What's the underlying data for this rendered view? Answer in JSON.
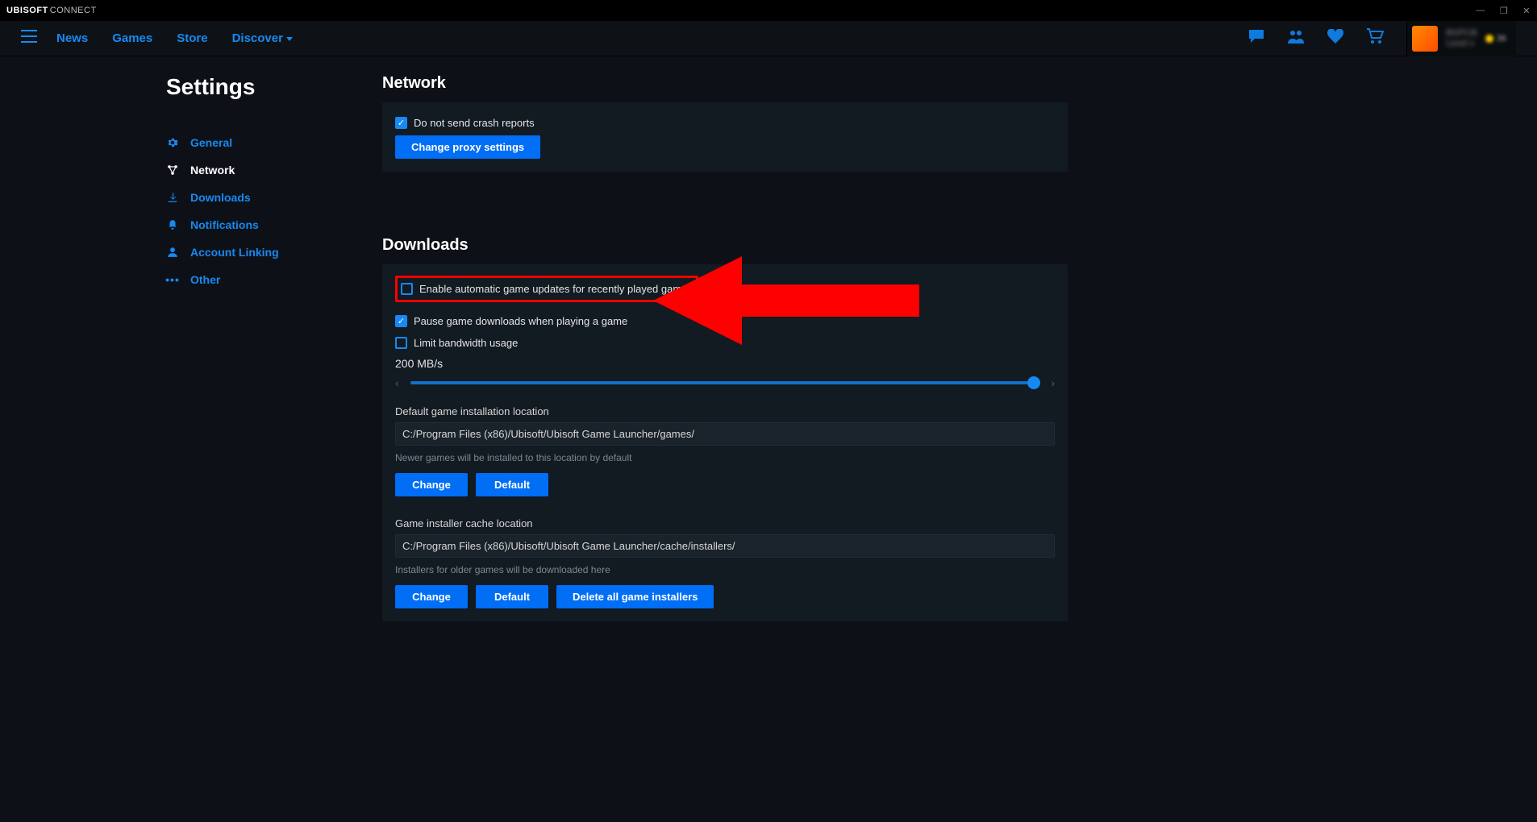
{
  "app": {
    "brand1": "UBISOFT",
    "brand2": "CONNECT"
  },
  "nav": {
    "news": "News",
    "games": "Games",
    "store": "Store",
    "discover": "Discover"
  },
  "profile": {
    "name_line1": "BGPCB",
    "name_line2": "Level x",
    "credits": "36"
  },
  "page_title": "Settings",
  "sidebar": {
    "general": "General",
    "network": "Network",
    "downloads": "Downloads",
    "notifications": "Notifications",
    "account_linking": "Account Linking",
    "other": "Other"
  },
  "network_section": {
    "heading": "Network",
    "crash_label": "Do not send crash reports",
    "crash_checked": true,
    "proxy_btn": "Change proxy settings"
  },
  "downloads_section": {
    "heading": "Downloads",
    "auto_update_label": "Enable automatic game updates for recently played games",
    "auto_update_checked": false,
    "pause_label": "Pause game downloads when playing a game",
    "pause_checked": true,
    "limit_bw_label": "Limit bandwidth usage",
    "limit_bw_checked": false,
    "bw_value": "200 MB/s",
    "install_loc_label": "Default game installation location",
    "install_loc_value": "C:/Program Files (x86)/Ubisoft/Ubisoft Game Launcher/games/",
    "install_loc_hint": "Newer games will be installed to this location by default",
    "change_btn": "Change",
    "default_btn": "Default",
    "cache_loc_label": "Game installer cache location",
    "cache_loc_value": "C:/Program Files (x86)/Ubisoft/Ubisoft Game Launcher/cache/installers/",
    "cache_loc_hint": "Installers for older games will be downloaded here",
    "delete_installers_btn": "Delete all game installers"
  }
}
